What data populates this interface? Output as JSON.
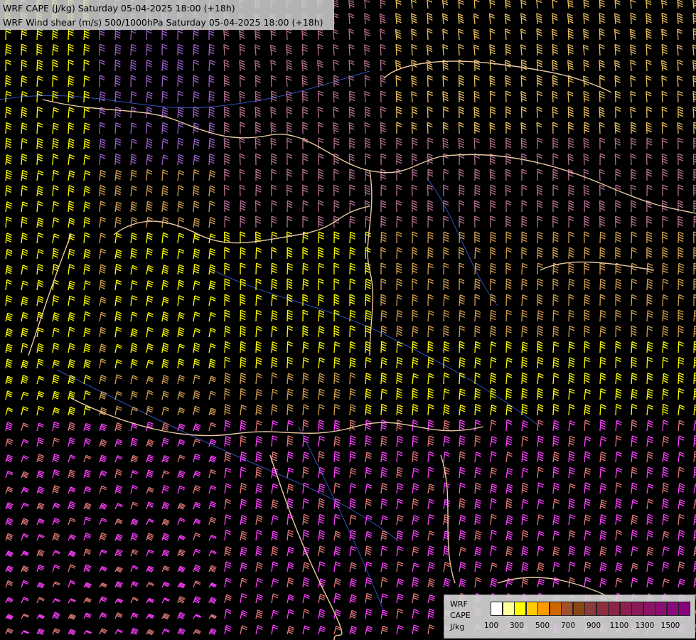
{
  "title": {
    "line1": "WRF CAPE (J/kg) Saturday 05-04-2025 18:00 (+18h)",
    "line2": "WRF Wind shear (m/s) 500/1000hPa Saturday 05-04-2025 18:00 (+18h)"
  },
  "legend": {
    "label_line1": "WRF",
    "label_line2": "CAPE",
    "label_line3": "J/kg",
    "swatch_colors": [
      "#ffffff",
      "#ffff99",
      "#ffff00",
      "#ffcc00",
      "#ff9900",
      "#cc6600",
      "#a0522d",
      "#8b4513",
      "#8b3a3a",
      "#8b2e3e",
      "#8b2548",
      "#8b1f50",
      "#8b1a5a",
      "#8b1465",
      "#8b0f70",
      "#8b0a7a",
      "#8b007f"
    ],
    "tick_labels": [
      "100",
      "300",
      "500",
      "700",
      "900",
      "1100",
      "1300",
      "1500"
    ]
  },
  "map": {
    "background": "#000000",
    "barb_colors": [
      "#ffff00",
      "#e8c060",
      "#d0a050",
      "#b07090",
      "#9a60c8",
      "#e07878",
      "#ff40ff",
      "#cc00cc"
    ],
    "border_color": "#e8c8a0",
    "river_color": "#3050c0"
  }
}
